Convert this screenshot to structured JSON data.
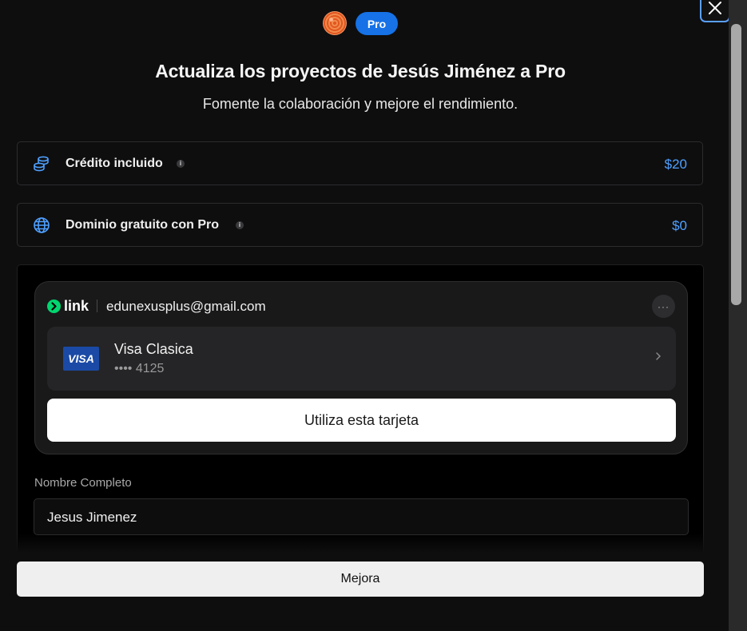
{
  "header": {
    "badge": "Pro",
    "title": "Actualiza los proyectos de Jesús Jiménez a Pro",
    "subtitle": "Fomente la colaboración y mejore el rendimiento."
  },
  "features": [
    {
      "label": "Crédito incluido",
      "value": "$20",
      "icon": "coins-icon"
    },
    {
      "label": "Dominio gratuito con Pro",
      "value": "$0",
      "icon": "globe-icon"
    }
  ],
  "link": {
    "brand": "link",
    "email": "edunexusplus@gmail.com",
    "more": "···",
    "card": {
      "brand": "VISA",
      "name": "Visa Clasica",
      "number": "•••• 4125"
    },
    "use_card_label": "Utiliza esta tarjeta"
  },
  "form": {
    "name_label": "Nombre Completo",
    "name_value": "Jesus Jimenez"
  },
  "upgrade_label": "Mejora",
  "colors": {
    "accent": "#1672e6",
    "price": "#4fa0ff",
    "link_green": "#00d66f",
    "visa_blue": "#1a4aa6"
  }
}
